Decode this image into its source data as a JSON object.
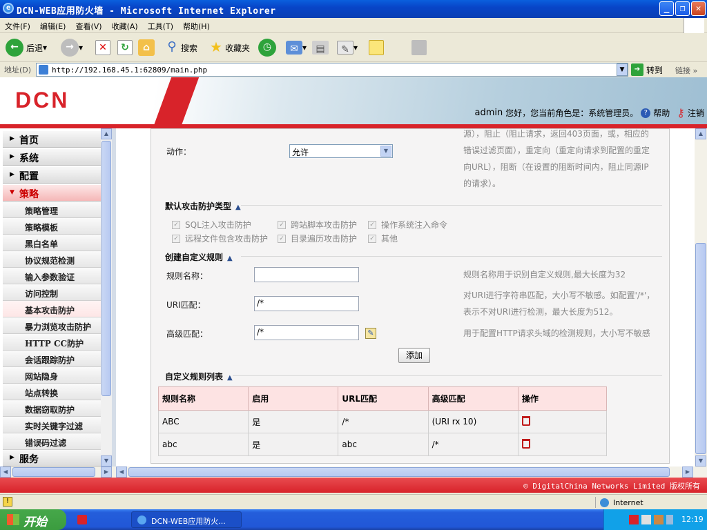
{
  "window": {
    "title": "DCN-WEB应用防火墙 - Microsoft Internet Explorer"
  },
  "menubar": [
    "文件(F)",
    "编辑(E)",
    "查看(V)",
    "收藏(A)",
    "工具(T)",
    "帮助(H)"
  ],
  "toolbar": {
    "back": "后退",
    "search": "搜索",
    "favorites": "收藏夹"
  },
  "address": {
    "label": "地址(D)",
    "url": "http://192.168.45.1:62809/main.php",
    "go": "转到",
    "links": "链接"
  },
  "header": {
    "logo": "DCN",
    "user": "admin",
    "greeting": "您好，您当前角色是：系统管理员。",
    "help": "帮助",
    "logout": "注销"
  },
  "sidebar": {
    "heads": [
      "首页",
      "系统",
      "配置",
      "策略",
      "服务"
    ],
    "items": [
      "策略管理",
      "策略模板",
      "黑白名单",
      "协议规范检测",
      "输入参数验证",
      "访问控制",
      "基本攻击防护",
      "暴力浏览攻击防护",
      "HTTP CC防护",
      "会话跟踪防护",
      "网站隐身",
      "站点转换",
      "数据窃取防护",
      "实时关键字过滤",
      "错误码过滤"
    ],
    "active_item": "基本攻击防护"
  },
  "form": {
    "action_label": "动作：",
    "action_value": "允许",
    "action_help": [
      "源），阻止（阻止请求，返回403页面，或，相应的",
      "错误过滤页面），重定向（重定向请求到配置的重定",
      "向URL），阻断（在设置的阻断时间内，阻止同源IP",
      "的请求）。"
    ],
    "attack_types_title": "默认攻击防护类型",
    "attack_types": [
      "SQL注入攻击防护",
      "跨站脚本攻击防护",
      "操作系统注入命令",
      "远程文件包含攻击防护",
      "目录遍历攻击防护",
      "其他"
    ],
    "custom_rule_title": "创建自定义规则",
    "rule_name_label": "规则名称：",
    "rule_name_value": "",
    "rule_name_help": "规则名称用于识别自定义规则,最大长度为32",
    "uri_label": "URI匹配：",
    "uri_value": "/*",
    "uri_help": [
      "对URI进行字符串匹配，大小写不敏感。如配置'/*'，",
      "表示不对URI进行检测，最大长度为512。"
    ],
    "adv_label": "高级匹配：",
    "adv_value": "/*",
    "adv_help": "用于配置HTTP请求头域的检测规则，大小写不敏感",
    "add_button": "添加"
  },
  "rule_list": {
    "title": "自定义规则列表",
    "columns": [
      "规则名称",
      "启用",
      "URL匹配",
      "高级匹配",
      "操作"
    ],
    "rows": [
      {
        "name": "ABC",
        "enabled": "是",
        "url": "/*",
        "adv": "(URI rx 10)"
      },
      {
        "name": "abc",
        "enabled": "是",
        "url": "abc",
        "adv": "/*"
      }
    ]
  },
  "footer": {
    "copyright": "© DigitalChina Networks Limited 版权所有"
  },
  "statusbar": {
    "zone": "Internet"
  },
  "taskbar": {
    "start": "开始",
    "task": "DCN-WEB应用防火...",
    "clock": "12:19"
  },
  "colors": {
    "brand_red": "#d8232a",
    "header_pink": "#fde3e3"
  }
}
